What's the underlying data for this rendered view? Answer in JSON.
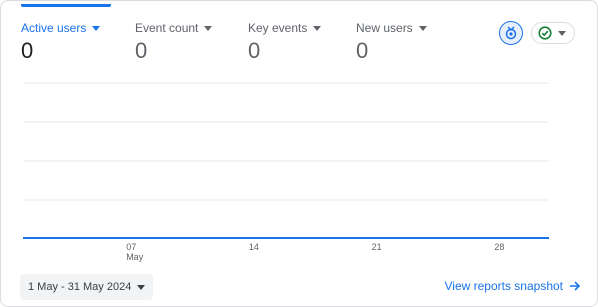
{
  "metrics": [
    {
      "label": "Active users",
      "value": "0"
    },
    {
      "label": "Event count",
      "value": "0"
    },
    {
      "label": "Key events",
      "value": "0"
    },
    {
      "label": "New users",
      "value": "0"
    }
  ],
  "chart_data": {
    "type": "line",
    "x_ticks": [
      {
        "day": "07",
        "month": "May"
      },
      {
        "day": "14",
        "month": ""
      },
      {
        "day": "21",
        "month": ""
      },
      {
        "day": "28",
        "month": ""
      }
    ],
    "series": [
      {
        "values": [
          0,
          0,
          0,
          0,
          0,
          0,
          0,
          0,
          0,
          0,
          0,
          0,
          0,
          0,
          0,
          0,
          0,
          0,
          0,
          0,
          0,
          0,
          0,
          0,
          0,
          0,
          0,
          0,
          0,
          0,
          0
        ]
      }
    ],
    "x_range": [
      "2024-05-01",
      "2024-05-31"
    ],
    "grid": true
  },
  "footer": {
    "date_range": "1 May - 31 May 2024",
    "view_link": "View reports snapshot"
  },
  "colors": {
    "accent": "#1a73e8",
    "status_ok": "#188038"
  },
  "icons": {
    "insights": "insights-icon",
    "status": "check-circle-icon",
    "arrow": "arrow-forward-icon"
  }
}
